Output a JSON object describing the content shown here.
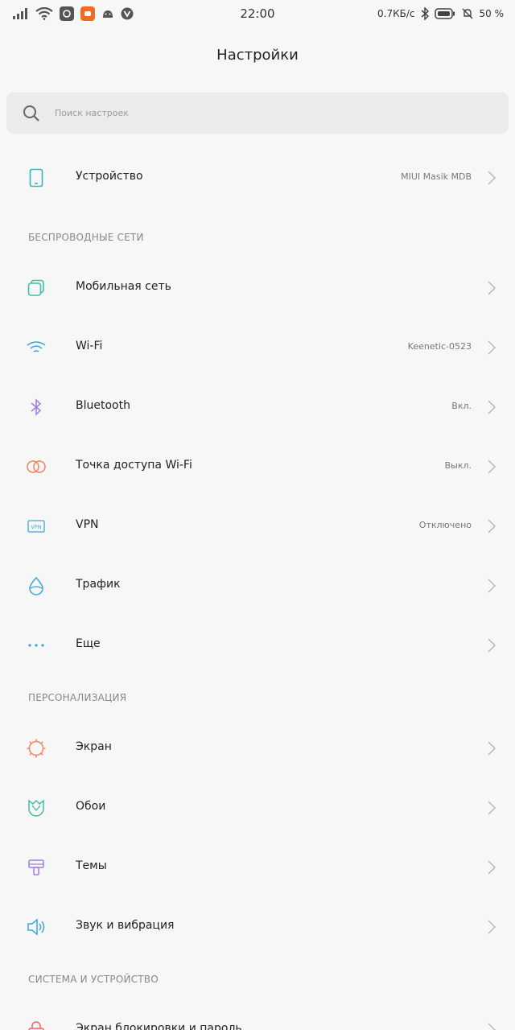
{
  "status_bar": {
    "time": "22:00",
    "speed": "0.7КБ/с",
    "battery": "50 %",
    "icons": [
      "signal-icon",
      "wifi-icon",
      "app-icon",
      "app-icon",
      "android-icon",
      "app-icon",
      "bluetooth-icon",
      "battery-icon",
      "mute-icon"
    ]
  },
  "header": {
    "title": "Настройки"
  },
  "search": {
    "placeholder": "Поиск настроек"
  },
  "sections": {
    "wireless": "БЕСПРОВОДНЫЕ СЕТИ",
    "personal": "ПЕРСОНАЛИЗАЦИЯ",
    "system": "СИСТЕМА И УСТРОЙСТВО"
  },
  "items": {
    "device": {
      "label": "Устройство",
      "value": "MIUI Masik MDB",
      "icon": "phone-icon"
    },
    "mobile": {
      "label": "Мобильная сеть",
      "value": "",
      "icon": "sim-icon"
    },
    "wifi": {
      "label": "Wi-Fi",
      "value": "Keenetic-0523",
      "icon": "wifi-icon"
    },
    "bt": {
      "label": "Bluetooth",
      "value": "Вкл.",
      "icon": "bluetooth-icon"
    },
    "hotspot": {
      "label": "Точка доступа Wi-Fi",
      "value": "Выкл.",
      "icon": "hotspot-icon"
    },
    "vpn": {
      "label": "VPN",
      "value": "Отключено",
      "icon": "vpn-icon"
    },
    "traffic": {
      "label": "Трафик",
      "value": "",
      "icon": "droplet-icon"
    },
    "more": {
      "label": "Еще",
      "value": "",
      "icon": "more-icon"
    },
    "screen": {
      "label": "Экран",
      "value": "",
      "icon": "sun-icon"
    },
    "wallpaper": {
      "label": "Обои",
      "value": "",
      "icon": "tulip-icon"
    },
    "themes": {
      "label": "Темы",
      "value": "",
      "icon": "brush-icon"
    },
    "sound": {
      "label": "Звук и вибрация",
      "value": "",
      "icon": "speaker-icon"
    },
    "lock": {
      "label": "Экран блокировки и пароль",
      "value": "",
      "icon": "lock-icon"
    }
  },
  "colors": {
    "teal": "#3ab0c4",
    "green": "#3dbfa6",
    "blue": "#38a7d8",
    "purple": "#a07ee0",
    "orange": "#f0855f",
    "gray_text": "#777777",
    "chevron": "#b8b8b8"
  }
}
